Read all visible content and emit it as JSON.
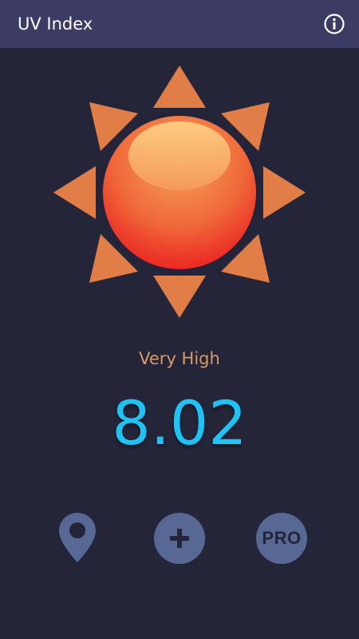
{
  "app_bar": {
    "title": "UV Index",
    "info_icon": "info-icon"
  },
  "sun_icon": "sun-icon",
  "uv": {
    "level_label": "Very High",
    "value": "8.02"
  },
  "actions": {
    "location_icon": "location-pin-icon",
    "add_icon": "plus-icon",
    "pro_label": "PRO"
  },
  "colors": {
    "background": "#25253a",
    "app_bar": "#3c3b63",
    "level_text": "#d99a67",
    "value_text": "#1fc2f4",
    "button_fill": "#566893",
    "sun_ray": "#e17d46",
    "sun_core": "#f0452e"
  }
}
